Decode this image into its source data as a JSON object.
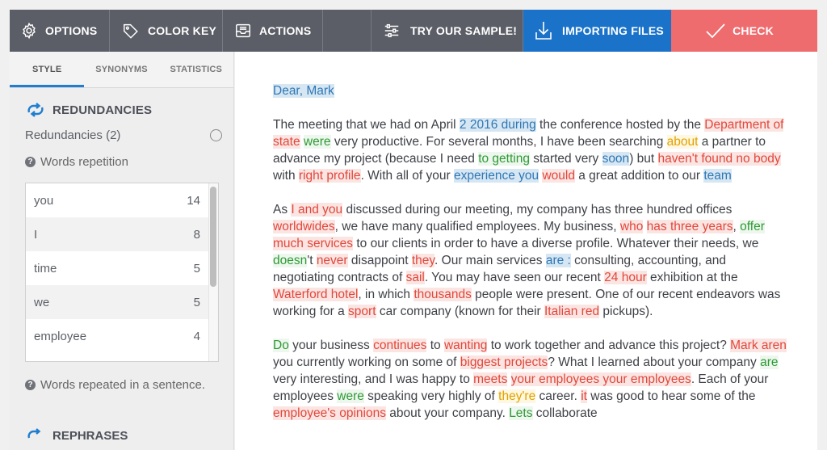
{
  "toolbar": {
    "options": "OPTIONS",
    "color_key": "COLOR KEY",
    "actions": "ACTIONS",
    "sample": "TRY OUR SAMPLE!",
    "importing": "IMPORTING FILES",
    "check": "CHECK"
  },
  "sidebar": {
    "tabs": [
      "STYLE",
      "SYNONYMS",
      "STATISTICS"
    ],
    "section_title": "REDUNDANCIES",
    "redundancies_label": "Redundancies (2)",
    "words_repetition": "Words repetition",
    "words": [
      {
        "word": "you",
        "count": "14"
      },
      {
        "word": "I",
        "count": "8"
      },
      {
        "word": "time",
        "count": "5"
      },
      {
        "word": "we",
        "count": "5"
      },
      {
        "word": "employee",
        "count": "4"
      }
    ],
    "words_in_sentence": "Words repeated in a sentence.",
    "rephrases": "REPHRASES"
  },
  "colors": {
    "toolbar_bg": "#5b5e66",
    "import_bg": "#1a73c9",
    "check_bg": "#ee6b6e",
    "highlight_blue": "#d6e7f3",
    "highlight_red": "#fbe5e3",
    "text_green": "#2e9a34",
    "text_yellow": "#e0a200"
  },
  "document": {
    "paragraphs": [
      [
        {
          "t": "Dear, Mark",
          "c": "hb"
        }
      ],
      [
        {
          "t": "The meeting that we had on April "
        },
        {
          "t": "2 2016 during",
          "c": "hb"
        },
        {
          "t": " the conference hosted by the "
        },
        {
          "t": "Department of state",
          "c": "hr"
        },
        {
          "t": " "
        },
        {
          "t": "were",
          "c": "hg"
        },
        {
          "t": " very productive. For several months, I have been searching "
        },
        {
          "t": "about",
          "c": "hy"
        },
        {
          "t": " a partner to advance my project (because I need "
        },
        {
          "t": "to getting",
          "c": "hg"
        },
        {
          "t": " started very "
        },
        {
          "t": "soon",
          "c": "hb"
        },
        {
          "t": ") but "
        },
        {
          "t": "haven't found no body",
          "c": "hr"
        },
        {
          "t": " with "
        },
        {
          "t": "right profile",
          "c": "hr"
        },
        {
          "t": ". With all of your "
        },
        {
          "t": "experience you",
          "c": "hb"
        },
        {
          "t": " "
        },
        {
          "t": "would",
          "c": "hr"
        },
        {
          "t": " a great addition to our "
        },
        {
          "t": "team",
          "c": "hb"
        }
      ],
      [
        {
          "t": "As "
        },
        {
          "t": "I and you",
          "c": "hr"
        },
        {
          "t": " discussed during our meeting, my company has three hundred offices "
        },
        {
          "t": "worldwides",
          "c": "hr"
        },
        {
          "t": ", we have many qualified employees. My business, "
        },
        {
          "t": "who",
          "c": "hr"
        },
        {
          "t": " "
        },
        {
          "t": "has three years",
          "c": "hr"
        },
        {
          "t": ", "
        },
        {
          "t": "offer",
          "c": "hg"
        },
        {
          "t": " "
        },
        {
          "t": "much services",
          "c": "hr"
        },
        {
          "t": " to our clients in order to have a diverse profile. Whatever their needs, we "
        },
        {
          "t": "doesn",
          "c": "hg"
        },
        {
          "t": "'t "
        },
        {
          "t": "never",
          "c": "hr"
        },
        {
          "t": " disappoint "
        },
        {
          "t": "they",
          "c": "hr"
        },
        {
          "t": ". Our main services "
        },
        {
          "t": "are :",
          "c": "hb"
        },
        {
          "t": " consulting, accounting, and negotiating contracts of "
        },
        {
          "t": "sail",
          "c": "hr"
        },
        {
          "t": ". You may have seen our recent "
        },
        {
          "t": "24 hour",
          "c": "hr"
        },
        {
          "t": " exhibition at the "
        },
        {
          "t": "Waterford hotel",
          "c": "hr"
        },
        {
          "t": ", in which "
        },
        {
          "t": "thousands",
          "c": "hr"
        },
        {
          "t": " people were present. One of our recent endeavors was working for a "
        },
        {
          "t": "sport",
          "c": "hr"
        },
        {
          "t": " car company (known for their "
        },
        {
          "t": "Italian red",
          "c": "hr"
        },
        {
          "t": " pickups)."
        }
      ],
      [
        {
          "t": "Do",
          "c": "hg"
        },
        {
          "t": " your business "
        },
        {
          "t": "continues",
          "c": "hr"
        },
        {
          "t": " to "
        },
        {
          "t": "wanting",
          "c": "hr"
        },
        {
          "t": " to work together and advance this project? "
        },
        {
          "t": "Mark aren",
          "c": "hr"
        },
        {
          "t": " you currently working on some of "
        },
        {
          "t": "biggest projects",
          "c": "hr"
        },
        {
          "t": "? What I learned about your company "
        },
        {
          "t": "are",
          "c": "hg"
        },
        {
          "t": " very interesting, and I was happy to "
        },
        {
          "t": "meets",
          "c": "hr"
        },
        {
          "t": " "
        },
        {
          "t": "your employees your employees",
          "c": "hr"
        },
        {
          "t": ". Each of your employees "
        },
        {
          "t": "were",
          "c": "hg"
        },
        {
          "t": " speaking very highly of "
        },
        {
          "t": "they're",
          "c": "hy"
        },
        {
          "t": " career. "
        },
        {
          "t": "it",
          "c": "hr"
        },
        {
          "t": " was good to hear some of the "
        },
        {
          "t": "employee's opinions",
          "c": "hr"
        },
        {
          "t": " about your company. "
        },
        {
          "t": "Lets",
          "c": "hg"
        },
        {
          "t": " collaborate"
        }
      ]
    ]
  }
}
